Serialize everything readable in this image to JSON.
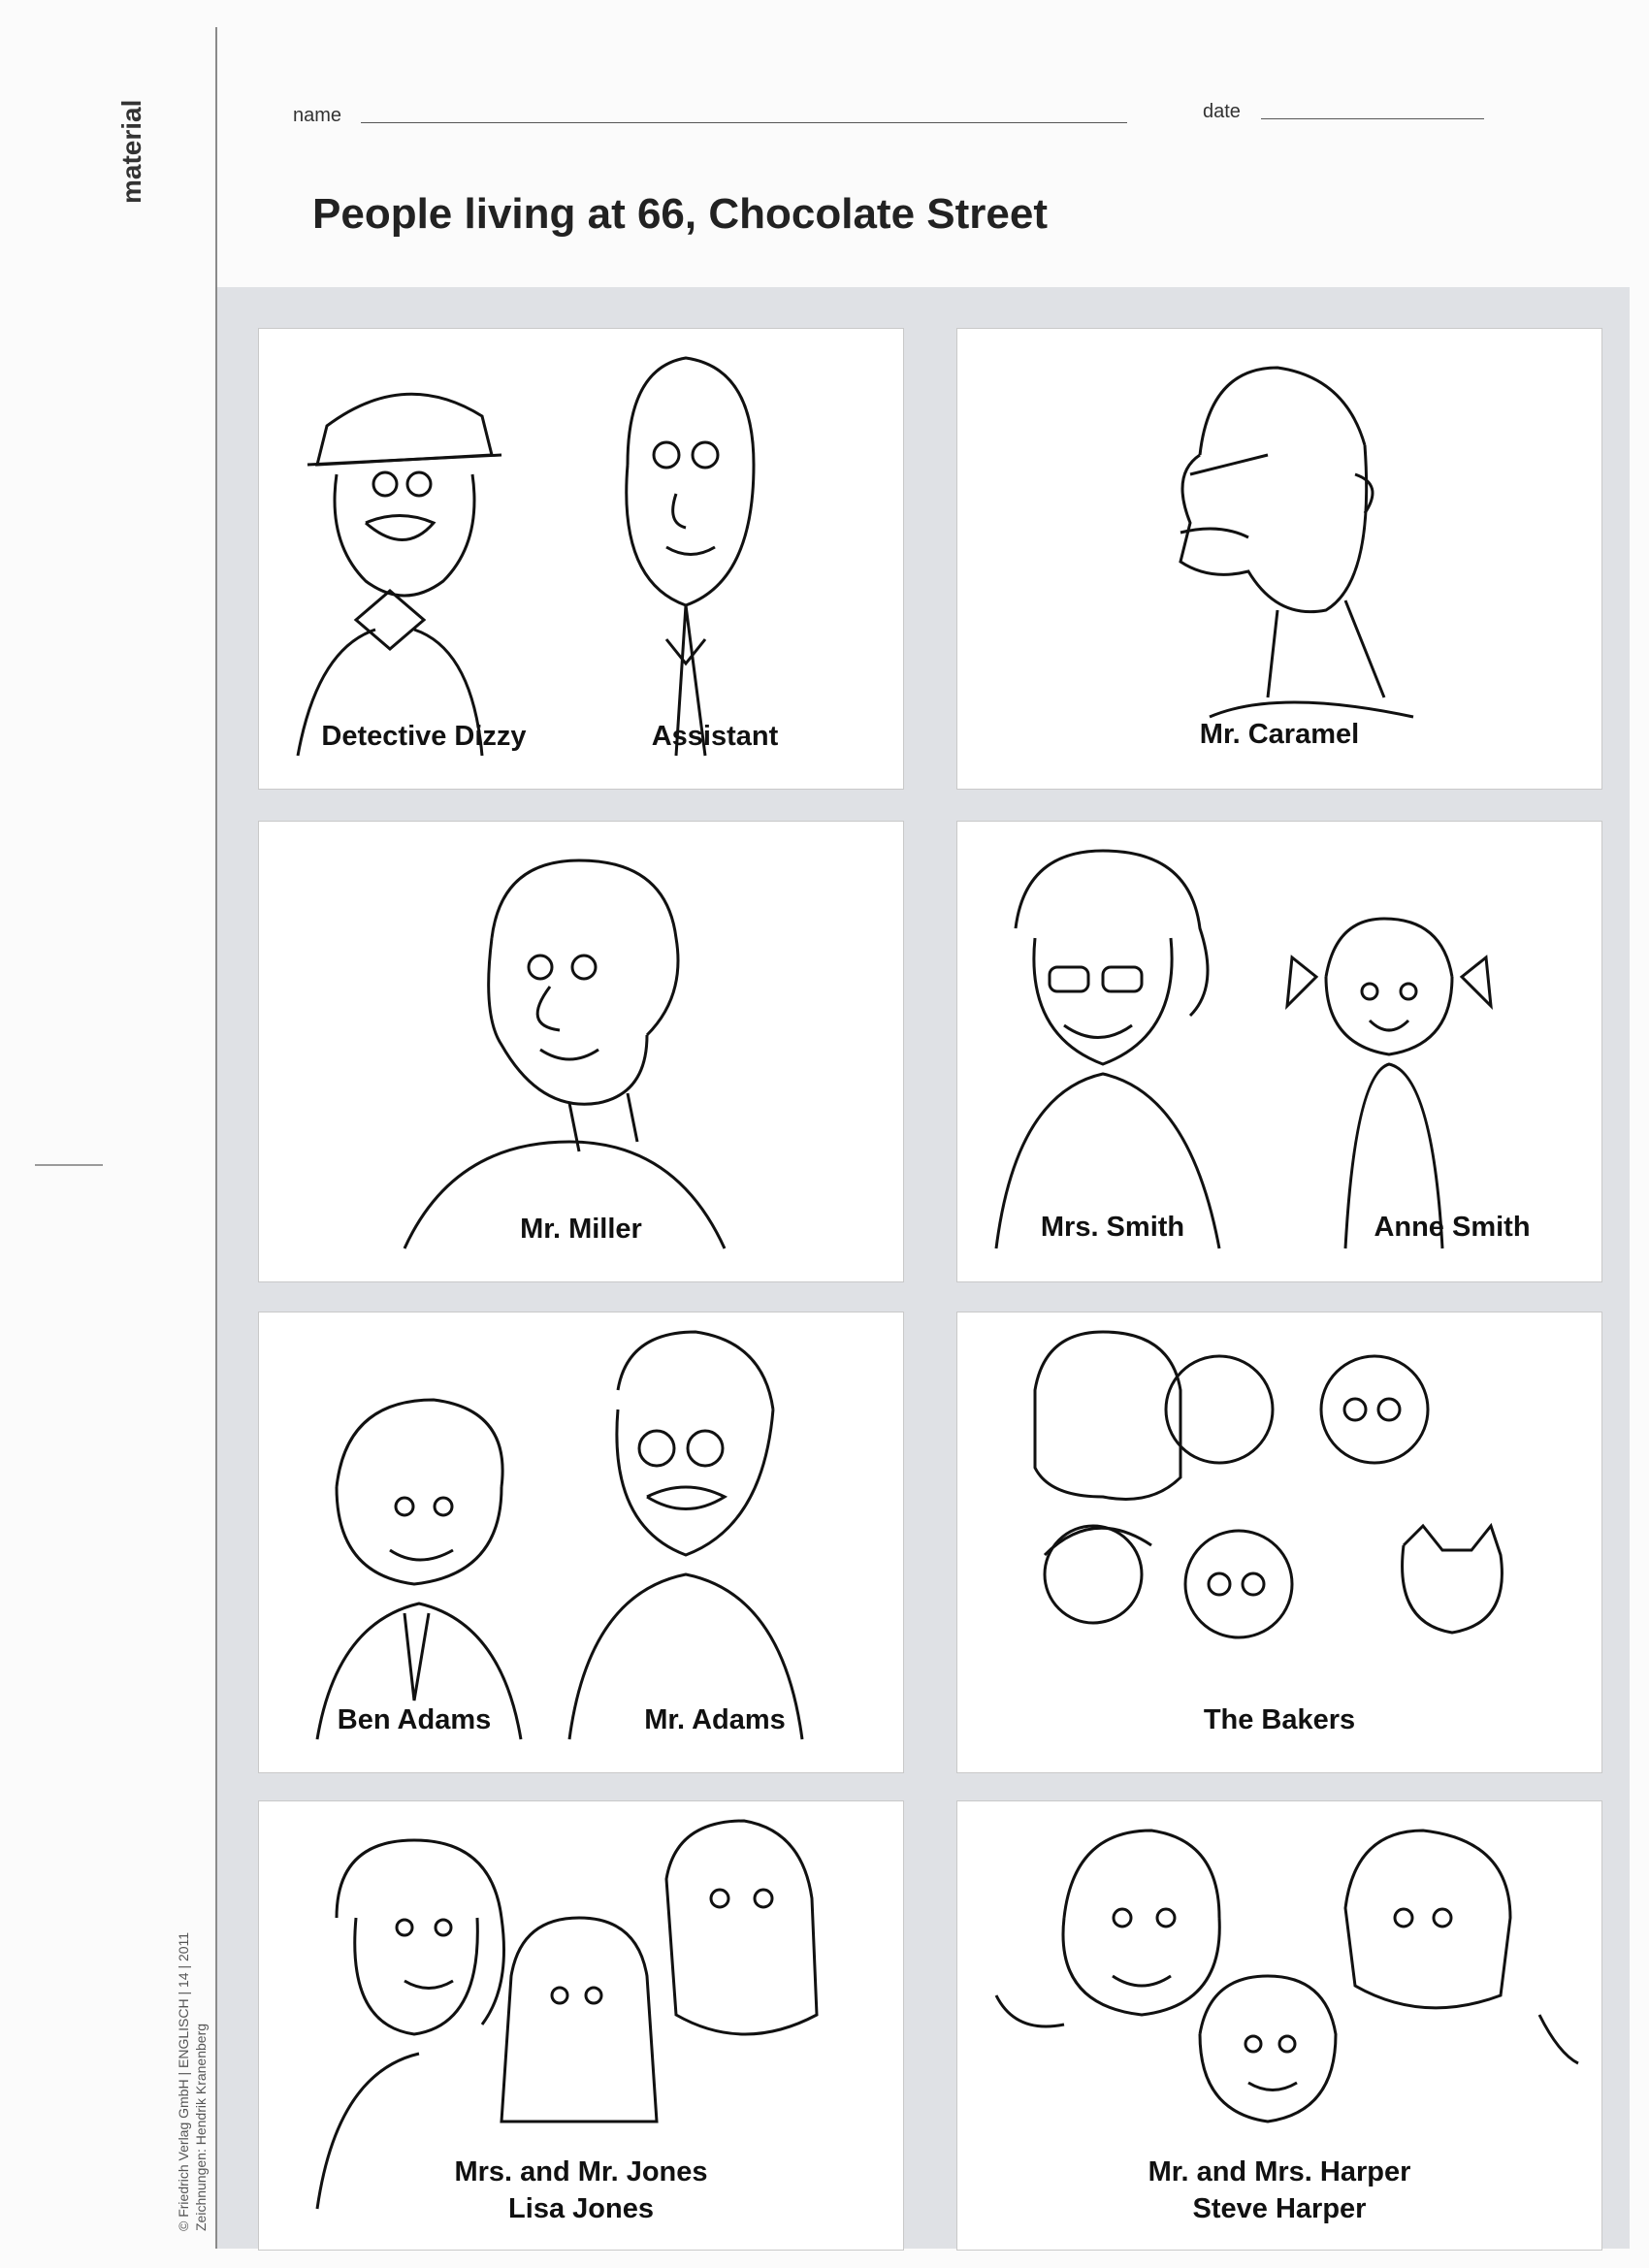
{
  "sidebar": {
    "section_label": "material",
    "copyright": "© Friedrich Verlag GmbH | ENGLISCH | 14 | 2011",
    "credit": "Zeichnungen: Hendrik Kranenberg"
  },
  "header": {
    "name_label": "name",
    "date_label": "date",
    "title": "People living at 66, Chocolate Street"
  },
  "cards": {
    "c1": {
      "left": "Detective Dizzy",
      "right": "Assistant"
    },
    "c2": {
      "single": "Mr. Caramel"
    },
    "c3": {
      "single": "Mr. Miller"
    },
    "c4": {
      "left": "Mrs. Smith",
      "right": "Anne Smith"
    },
    "c5": {
      "left": "Ben Adams",
      "right": "Mr. Adams"
    },
    "c6": {
      "single": "The Bakers"
    },
    "c7": {
      "line1": "Mrs. and Mr. Jones",
      "line2": "Lisa Jones"
    },
    "c8": {
      "line1": "Mr. and Mrs. Harper",
      "line2": "Steve Harper"
    }
  },
  "colors": {
    "band": "#dfe1e5",
    "ink": "#111111"
  }
}
